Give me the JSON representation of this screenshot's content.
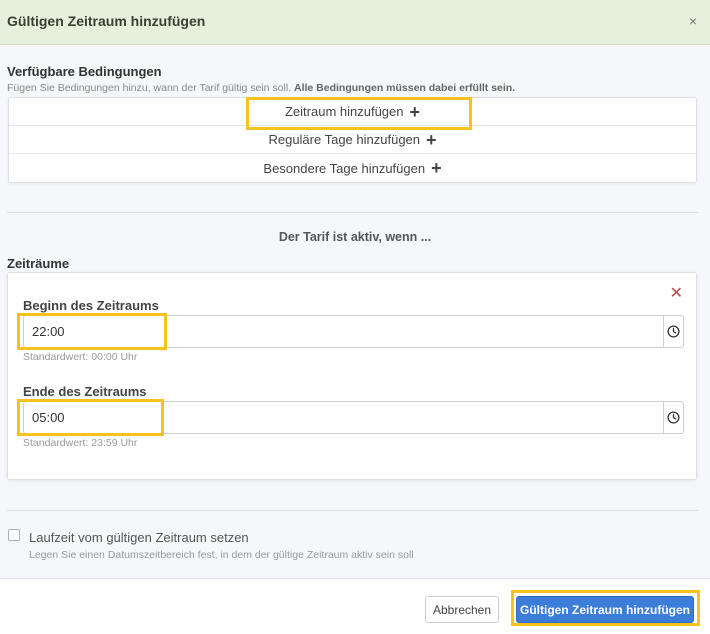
{
  "modal": {
    "title": "Gültigen Zeitraum hinzufügen",
    "close": "×"
  },
  "conditions": {
    "title": "Verfügbare Bedingungen",
    "desc_plain": "Fügen Sie Bedingungen hinzu, wann der Tarif gültig sein soll. ",
    "desc_bold": "Alle Bedingungen müssen dabei erfüllt sein.",
    "items": [
      {
        "label": "Zeitraum hinzufügen",
        "icon": "plus-icon"
      },
      {
        "label": "Reguläre Tage hinzufügen",
        "icon": "plus-icon"
      },
      {
        "label": "Besondere Tage hinzufügen",
        "icon": "plus-icon"
      }
    ]
  },
  "active_when": "Der Tarif ist aktiv, wenn ...",
  "periods": {
    "title": "Zeiträume",
    "remove": "✕",
    "start": {
      "label": "Beginn des Zeitraums",
      "value": "22:00",
      "hint": "Standardwert: 00:00 Uhr"
    },
    "end": {
      "label": "Ende des Zeitraums",
      "value": "05:00",
      "hint": "Standardwert: 23:59 Uhr"
    }
  },
  "runtime": {
    "label": "Laufzeit vom gültigen Zeitraum setzen",
    "desc": "Legen Sie einen Datumszeitbereich fest, in dem der gültige Zeitraum aktiv sein soll"
  },
  "footer": {
    "cancel": "Abbrechen",
    "submit": "Gültigen Zeitraum hinzufügen"
  },
  "colors": {
    "header_bg": "#e6f0dc",
    "primary": "#3b7dd8",
    "highlight": "#f7c21b",
    "danger": "#b94a48"
  }
}
